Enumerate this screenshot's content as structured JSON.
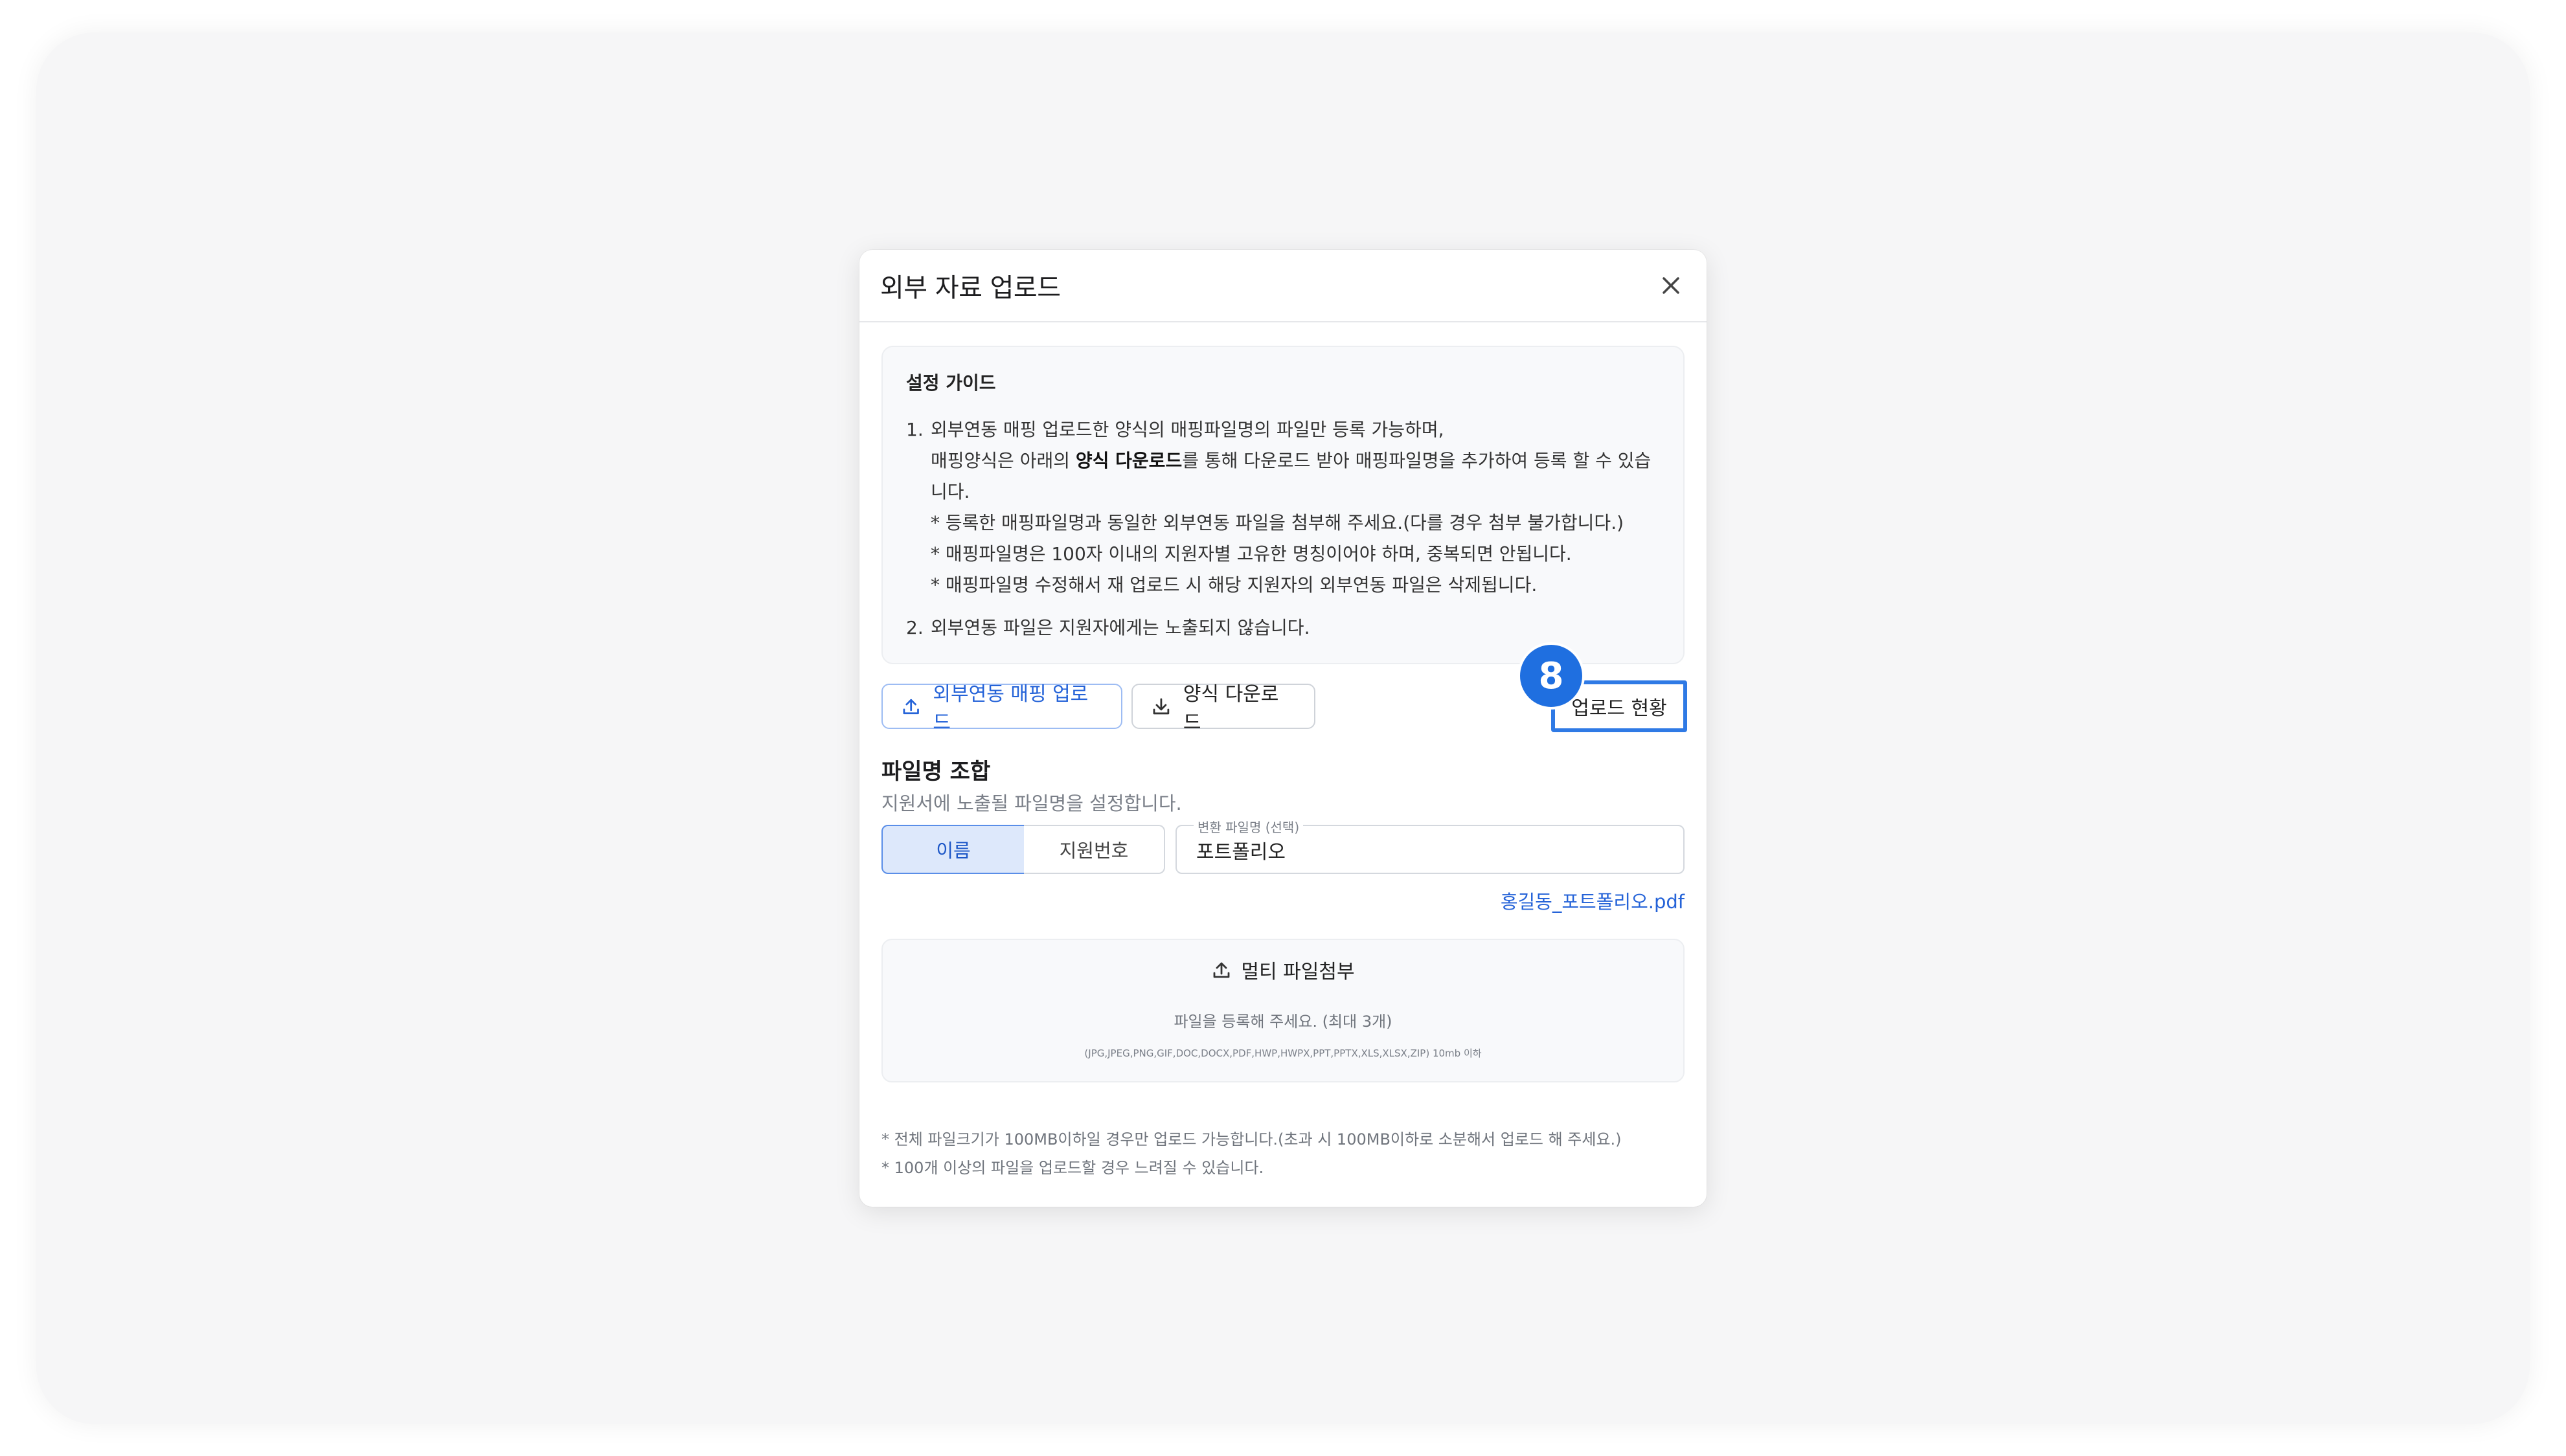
{
  "modal": {
    "title": "외부 자료 업로드",
    "close_icon": "close-icon"
  },
  "guide": {
    "title": "설정 가이드",
    "item1_num": "1.",
    "item1_line1": "외부연동 매핑 업로드한 양식의 매핑파일명의 파일만 등록 가능하며,",
    "item1_line2_pre": "매핑양식은 아래의 ",
    "item1_line2_bold": "양식 다운로드",
    "item1_line2_post": "를 통해 다운로드 받아 매핑파일명을 추가하여 등록 할 수 있습",
    "item1_line3": "니다.",
    "note1": "* 등록한 매핑파일명과 동일한 외부연동 파일을 첨부해 주세요.(다를 경우 첨부 불가합니다.)",
    "note2": "* 매핑파일명은 100자 이내의 지원자별 고유한 명칭이어야 하며, 중복되면 안됩니다.",
    "note3": "* 매핑파일명 수정해서 재 업로드 시 해당 지원자의 외부연동 파일은 삭제됩니다.",
    "item2_num": "2.",
    "item2_text": "외부연동 파일은 지원자에게는 노출되지 않습니다."
  },
  "actions": {
    "mapping_upload_label": "외부연동 매핑 업로드",
    "template_download_label": "양식 다운로드",
    "upload_status_label": "업로드 현황",
    "badge_number": "8"
  },
  "filename": {
    "title": "파일명 조합",
    "description": "지원서에 노출될 파일명을 설정합니다.",
    "segments": [
      "이름",
      "지원번호"
    ],
    "selected_segment": "이름",
    "field_label": "변환 파일명 (선택)",
    "field_value": "포트폴리오",
    "preview": "홍길동_포트폴리오.pdf"
  },
  "dropzone": {
    "button_label": "멀티 파일첨부",
    "hint": "파일을 등록해 주세요. (최대 3개)",
    "types": "(JPG,JPEG,PNG,GIF,DOC,DOCX,PDF,HWP,HWPX,PPT,PPTX,XLS,XLSX,ZIP) 10mb 이하"
  },
  "notes": [
    "* 전체 파일크기가 100MB이하일 경우만 업로드 가능합니다.(초과 시 100MB이하로 소분해서 업로드 해 주세요.)",
    "* 100개 이상의 파일을 업로드할 경우 느려질 수 있습니다."
  ],
  "colors": {
    "accent": "#2563d8",
    "highlight_border": "#2f7ae5",
    "badge": "#1f6fe0"
  }
}
